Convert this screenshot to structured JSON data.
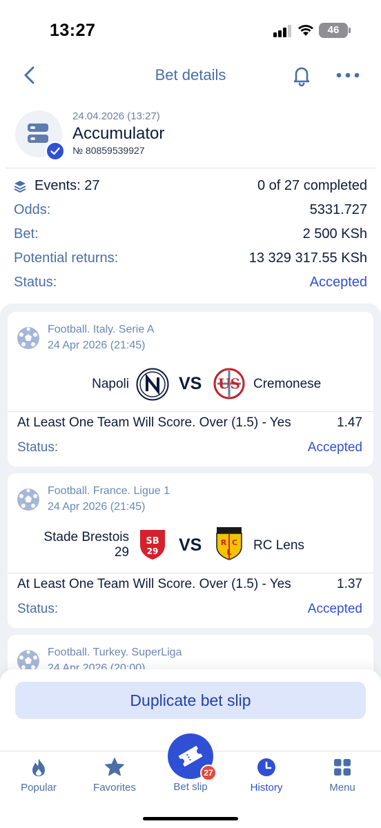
{
  "status_bar": {
    "time": "13:27",
    "battery": "46"
  },
  "header": {
    "title": "Bet details"
  },
  "bet": {
    "date": "24.04.2026 (13:27)",
    "type": "Accumulator",
    "number": "№ 80859539927",
    "events_label": "Events: 27",
    "events_progress": "0 of 27 completed",
    "odds_label": "Odds:",
    "odds_value": "5331.727",
    "bet_label": "Bet:",
    "bet_value": "2 500 KSh",
    "returns_label": "Potential returns:",
    "returns_value": "13 329 317.55 KSh",
    "status_label": "Status:",
    "status_value": "Accepted"
  },
  "events": [
    {
      "league": "Football. Italy. Serie A",
      "date": "24 Apr 2026 (21:45)",
      "home": "Napoli",
      "vs": "VS",
      "away": "Cremonese",
      "market": "At Least One Team Will Score. Over (1.5) - Yes",
      "odd": "1.47",
      "status_label": "Status:",
      "status_value": "Accepted"
    },
    {
      "league": "Football. France. Ligue 1",
      "date": "24 Apr 2026 (21:45)",
      "home_line1": "Stade Brestois",
      "home_line2": "29",
      "vs": "VS",
      "away": "RC Lens",
      "market": "At Least One Team Will Score. Over (1.5) - Yes",
      "odd": "1.37",
      "status_label": "Status:",
      "status_value": "Accepted"
    },
    {
      "league": "Football. Turkey. SuperLiga",
      "date": "24 Apr 2026 (20:00)"
    }
  ],
  "actions": {
    "duplicate": "Duplicate bet slip"
  },
  "tabbar": {
    "popular": "Popular",
    "favorites": "Favorites",
    "betslip": "Bet slip",
    "betslip_count": "27",
    "history": "History",
    "menu": "Menu"
  },
  "colors": {
    "accent": "#2f4fd4",
    "muted": "#4a6ea8",
    "badge": "#e5483b"
  }
}
